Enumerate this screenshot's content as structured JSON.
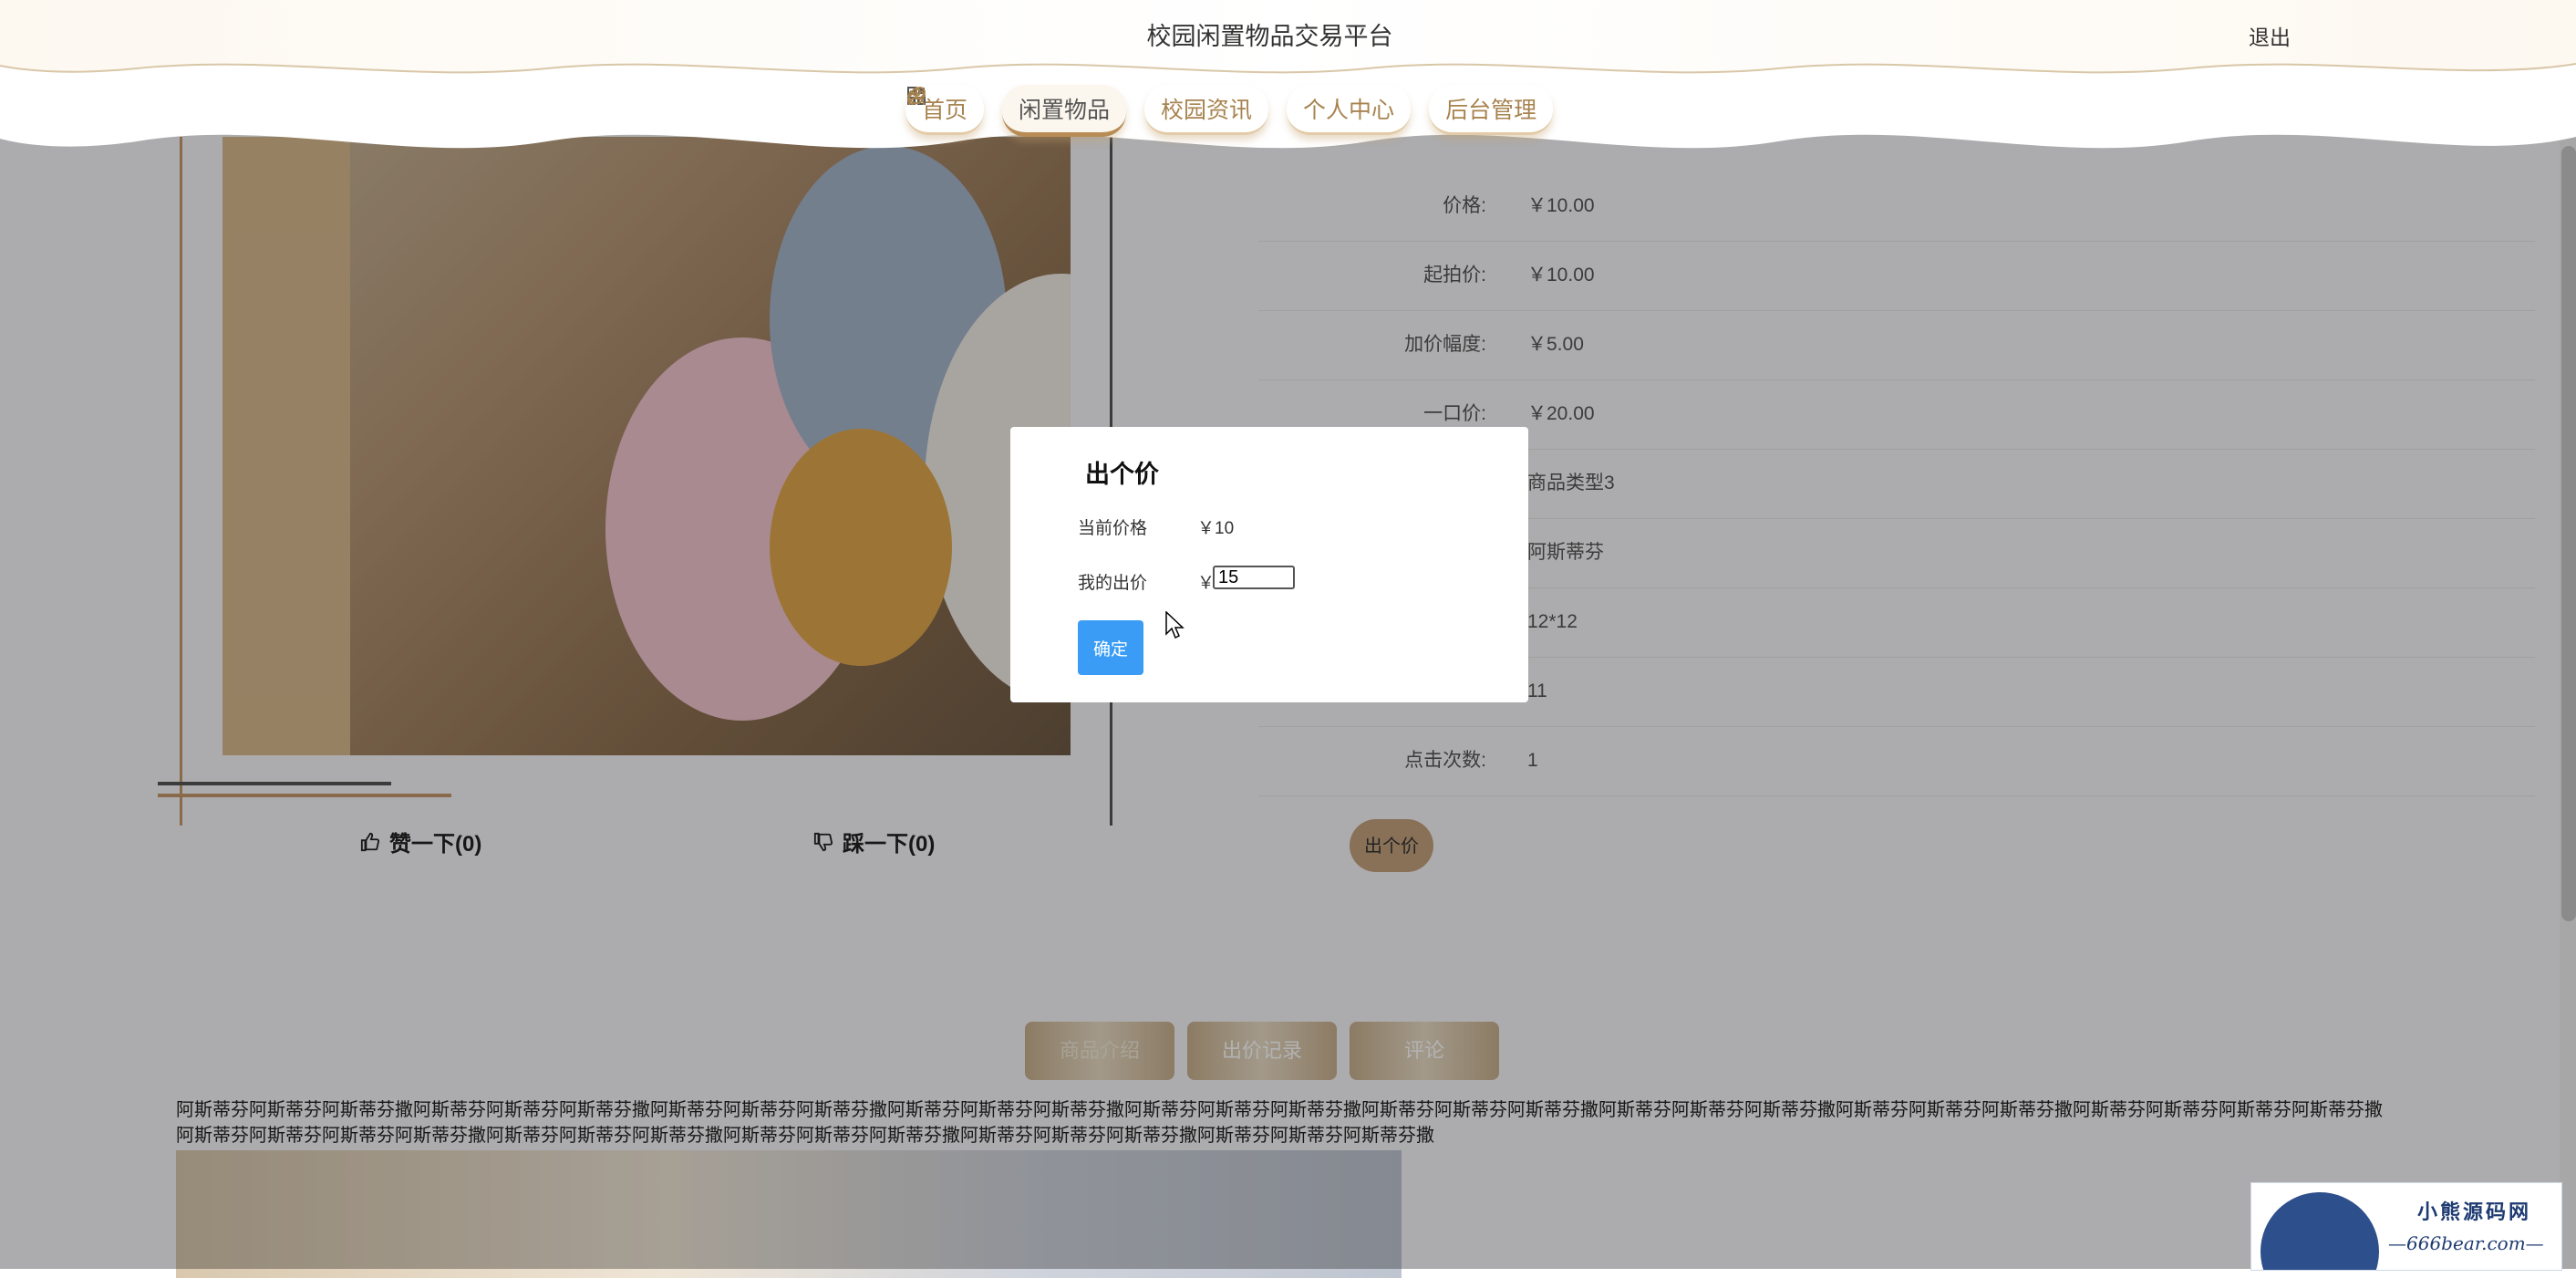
{
  "header": {
    "site_title": "校园闲置物品交易平台",
    "logout": "退出",
    "nav": [
      {
        "label": "首页",
        "icon": "home-icon"
      },
      {
        "label": "闲置物品",
        "icon": "grid-icon"
      },
      {
        "label": "校园资讯",
        "icon": "power-icon"
      },
      {
        "label": "个人中心",
        "icon": "user-icon"
      },
      {
        "label": "后台管理",
        "icon": "link-icon"
      }
    ]
  },
  "product": {
    "details": [
      {
        "label": "价格:",
        "value": "￥10.00"
      },
      {
        "label": "起拍价:",
        "value": "￥10.00"
      },
      {
        "label": "加价幅度:",
        "value": "￥5.00"
      },
      {
        "label": "一口价:",
        "value": "￥20.00"
      },
      {
        "label": "",
        "value": "商品类型3"
      },
      {
        "label": "",
        "value": "阿斯蒂芬"
      },
      {
        "label": "",
        "value": "12*12"
      },
      {
        "label": "",
        "value": "11"
      },
      {
        "label": "点击次数:",
        "value": "1"
      }
    ],
    "like_label": "赞一下(0)",
    "dislike_label": "踩一下(0)",
    "bid_button": "出个价"
  },
  "tabs": [
    "商品介绍",
    "出价记录",
    "评论"
  ],
  "description": "阿斯蒂芬阿斯蒂芬阿斯蒂芬撒阿斯蒂芬阿斯蒂芬阿斯蒂芬撒阿斯蒂芬阿斯蒂芬阿斯蒂芬撒阿斯蒂芬阿斯蒂芬阿斯蒂芬撒阿斯蒂芬阿斯蒂芬阿斯蒂芬撒阿斯蒂芬阿斯蒂芬阿斯蒂芬撒阿斯蒂芬阿斯蒂芬阿斯蒂芬撒阿斯蒂芬阿斯蒂芬阿斯蒂芬撒阿斯蒂芬阿斯蒂芬阿斯蒂芬阿斯蒂芬撒阿斯蒂芬阿斯蒂芬阿斯蒂芬阿斯蒂芬撒阿斯蒂芬阿斯蒂芬阿斯蒂芬撒阿斯蒂芬阿斯蒂芬阿斯蒂芬撒阿斯蒂芬阿斯蒂芬阿斯蒂芬撒阿斯蒂芬阿斯蒂芬阿斯蒂芬撒",
  "modal": {
    "title": "出个价",
    "current_price_label": "当前价格",
    "current_price_value": "￥10",
    "my_bid_label": "我的出价",
    "currency": "￥",
    "my_bid_value": "15",
    "confirm": "确定"
  },
  "watermark": {
    "line1": "小熊源码网",
    "line2": "—666bear.com—"
  },
  "colors": {
    "accent_gold": "#c49a6c",
    "confirm_blue": "#3a9cf5",
    "overlay": "rgba(0,0,0,0.30)"
  }
}
